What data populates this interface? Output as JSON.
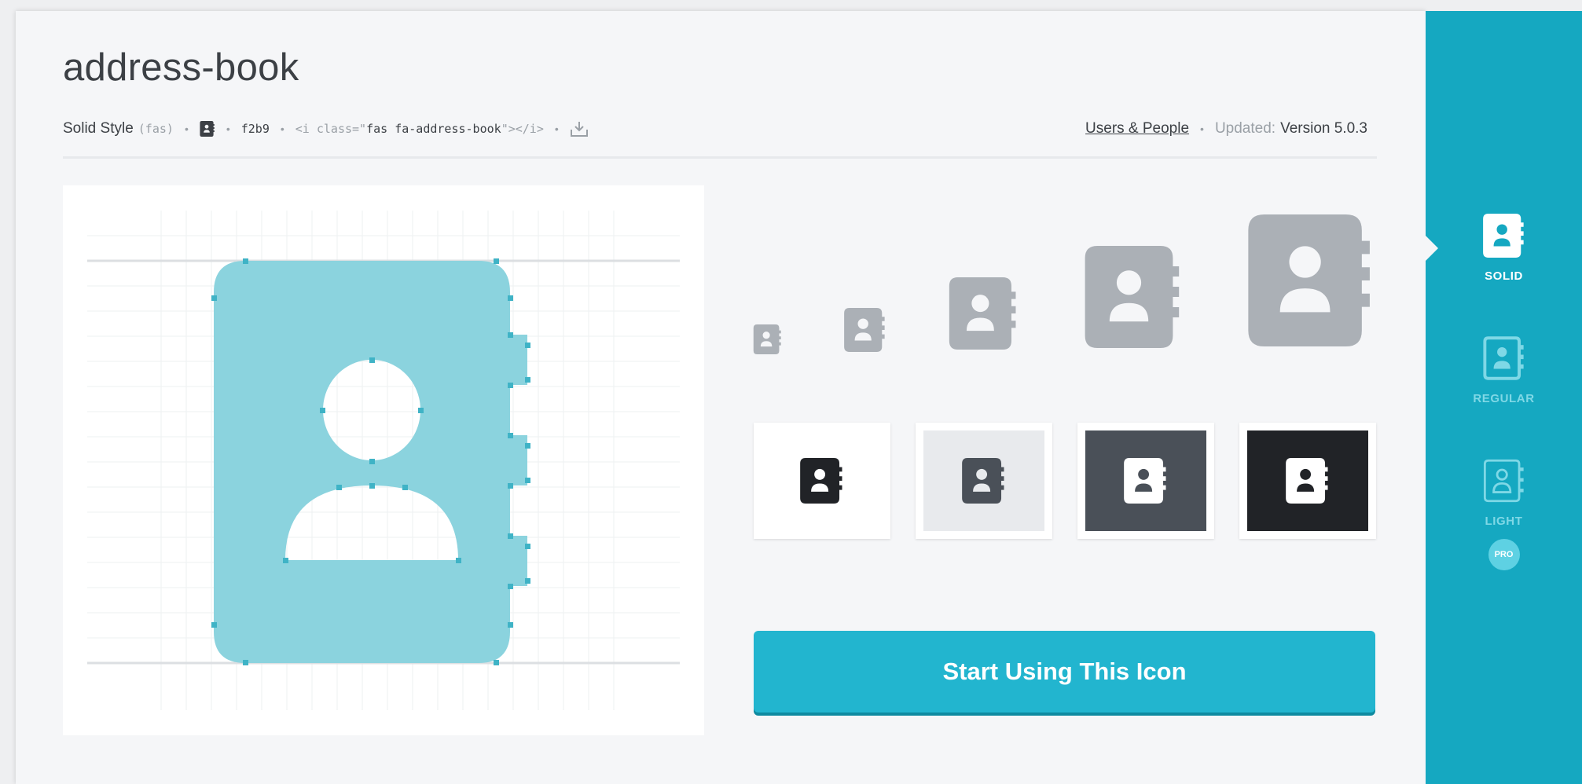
{
  "icon": {
    "name": "address-book",
    "style_name": "Solid Style",
    "style_prefix": "(fas)",
    "unicode": "f2b9",
    "code_open": "<i class=\"",
    "code_class": "fas fa-address-book",
    "code_close": "\"></i>",
    "category": "Users & People",
    "updated_label": "Updated:",
    "version": "Version 5.0.3"
  },
  "preview_backgrounds": [
    "#ffffff",
    "#e8eaed",
    "#4a5058",
    "#212327"
  ],
  "preview_icon_colors": [
    "#212327",
    "#4a5058",
    "#ffffff",
    "#ffffff"
  ],
  "cta_label": "Start Using This Icon",
  "styles": [
    {
      "label": "SOLID",
      "active": true,
      "pro": false
    },
    {
      "label": "REGULAR",
      "active": false,
      "pro": false
    },
    {
      "label": "LIGHT",
      "active": false,
      "pro": true
    }
  ],
  "pro_badge": "PRO",
  "colors": {
    "accent": "#22b5cf",
    "sidebar": "#15a8c1",
    "grid_fill": "#8bd3de",
    "size_preview_gray": "#abb0b6"
  }
}
